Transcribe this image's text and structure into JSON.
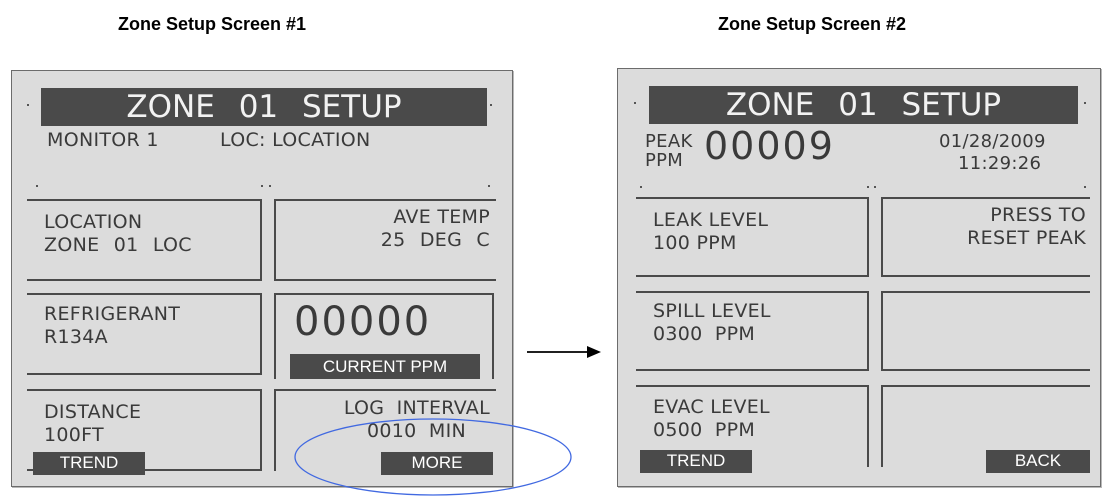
{
  "captions": {
    "screen1": "Zone Setup Screen #1",
    "screen2": "Zone Setup Screen #2"
  },
  "screen1": {
    "title": "ZONE 01 SETUP",
    "monitor": "MONITOR 1",
    "loc_label": "LOC: LOCATION",
    "location": {
      "label": "LOCATION",
      "value": "ZONE 01 LOC"
    },
    "ave_temp": {
      "label": "AVE TEMP",
      "value": "25 DEG C"
    },
    "refrigerant": {
      "label": "REFRIGERANT",
      "value": "R134A"
    },
    "current_ppm": {
      "value": "00000",
      "label": "CURRENT PPM"
    },
    "distance": {
      "label": "DISTANCE",
      "value": "100FT"
    },
    "log_interval": {
      "label": "LOG INTERVAL",
      "value": "0010 MIN"
    },
    "trend_button": "TREND",
    "more_button": "MORE"
  },
  "screen2": {
    "title": "ZONE 01 SETUP",
    "peak_label": "PEAK",
    "peak_unit": "PPM",
    "peak_value": "00009",
    "date": "01/28/2009",
    "time": "11:29:26",
    "leak_level": {
      "label": "LEAK LEVEL",
      "value": "100 PPM"
    },
    "reset_peak": {
      "line1": "PRESS TO",
      "line2": "RESET PEAK"
    },
    "spill_level": {
      "label": "SPILL LEVEL",
      "value": "0300 PPM"
    },
    "evac_level": {
      "label": "EVAC LEVEL",
      "value": "0500 PPM"
    },
    "trend_button": "TREND",
    "back_button": "BACK"
  },
  "colors": {
    "screen_bg": "#dcdcdc",
    "bar_dark": "#4a4a4a",
    "lcd_text": "#3a3a3a",
    "highlight_ellipse": "#4169e1"
  }
}
